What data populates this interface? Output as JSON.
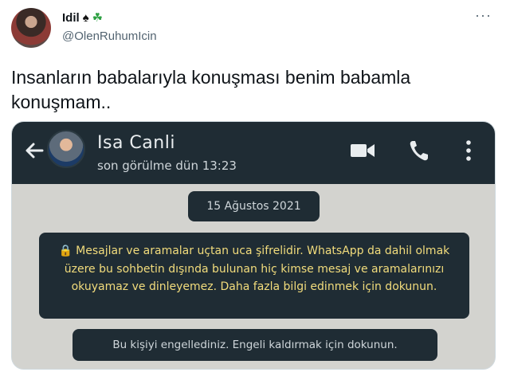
{
  "tweet": {
    "author_name": "Idil",
    "name_emojis": [
      "♠",
      "☘"
    ],
    "handle": "@OlenRuhumIcin",
    "more_icon": "more-horizontal-icon",
    "text": "Insanların babalarıyla konuşması benim babamla konuşmam.."
  },
  "whatsapp": {
    "contact_name": "Isa Canli",
    "last_seen": "son görülme dün 13:23",
    "icons": [
      "back-arrow-icon",
      "video-call-icon",
      "phone-call-icon",
      "kebab-menu-icon"
    ],
    "date_badge": "15 Ağustos 2021",
    "encryption_notice": "Mesajlar ve aramalar uçtan uca şifrelidir. WhatsApp da dahil olmak üzere bu sohbetin dışında bulunan hiç kimse mesaj ve aramalarınızı okuyamaz ve dinleyemez. Daha fazla bilgi edinmek için dokunun.",
    "blocked_notice": "Bu kişiyi engellediniz. Engeli kaldırmak için dokunun.",
    "colors": {
      "header_bg": "#1f2c34",
      "chat_bg": "#d3d3cf",
      "notice_text": "#f2dc7c"
    }
  }
}
